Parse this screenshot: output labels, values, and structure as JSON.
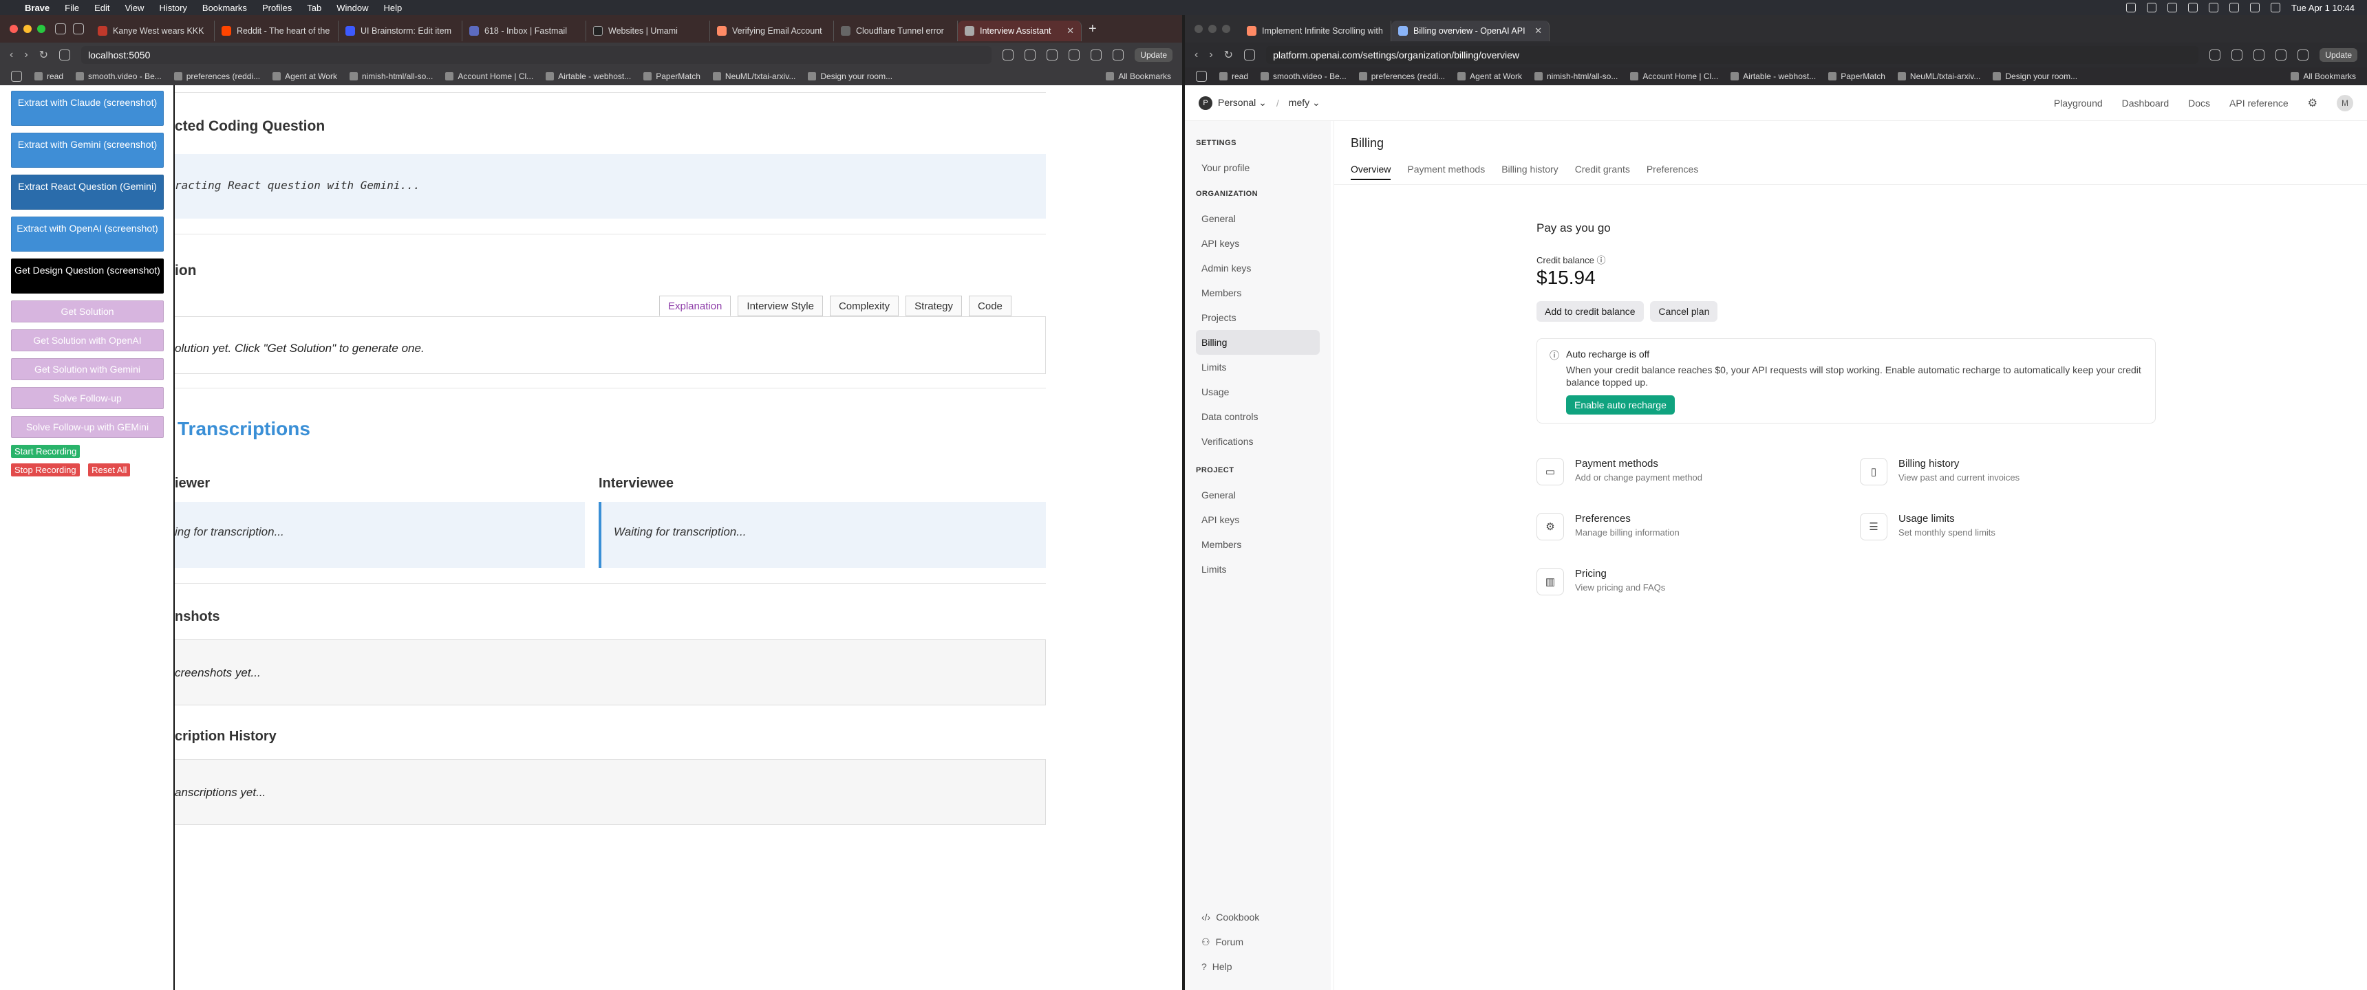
{
  "menubar": {
    "app": "Brave",
    "items": [
      "File",
      "Edit",
      "View",
      "History",
      "Bookmarks",
      "Profiles",
      "Tab",
      "Window",
      "Help"
    ],
    "clock": "Tue Apr 1  10:44"
  },
  "left_window": {
    "tabs": [
      {
        "title": "Kanye West wears KKK",
        "color": "#c0392b"
      },
      {
        "title": "Reddit - The heart of the",
        "color": "#ff4500"
      },
      {
        "title": "UI Brainstorm: Edit item",
        "color": "#3d5afe"
      },
      {
        "title": "618 - Inbox | Fastmail",
        "color": "#5c6bc0"
      },
      {
        "title": "Websites | Umami",
        "color": "#222"
      },
      {
        "title": "Verifying Email Account",
        "color": "#ff8a65"
      },
      {
        "title": "Cloudflare Tunnel error",
        "color": "#666"
      },
      {
        "title": "Interview Assistant",
        "color": "#aaa"
      }
    ],
    "url": "localhost:5050",
    "update_label": "Update",
    "bookmarks": [
      "read",
      "smooth.video - Be...",
      "preferences (reddi...",
      "Agent at Work",
      "nimish-html/all-so...",
      "Account Home | Cl...",
      "Airtable - webhost...",
      "PaperMatch",
      "NeuML/txtai-arxiv...",
      "Design your room..."
    ],
    "all_bookmarks": "All Bookmarks",
    "sidebar_buttons": [
      {
        "label": "Extract with Claude (screenshot)",
        "style": "blue"
      },
      {
        "label": "Extract with Gemini (screenshot)",
        "style": "blue"
      },
      {
        "label": "Extract React Question (Gemini)",
        "style": "dblue"
      },
      {
        "label": "Extract with OpenAI (screenshot)",
        "style": "blue"
      },
      {
        "label": "Get Design Question (screenshot)",
        "style": "black"
      },
      {
        "label": "Get Solution",
        "style": "lilac"
      },
      {
        "label": "Get Solution with OpenAI",
        "style": "lilac"
      },
      {
        "label": "Get Solution with Gemini",
        "style": "lilac"
      },
      {
        "label": "Solve Follow-up",
        "style": "lilac"
      },
      {
        "label": "Solve Follow-up with GEMini",
        "style": "lilac"
      }
    ],
    "start_recording": "Start Recording",
    "stop_recording": "Stop Recording",
    "reset_all": "Reset All",
    "extracted_heading": "cted Coding Question",
    "extracting_text": "racting React question with Gemini...",
    "solution_heading": "ion",
    "solution_tabs": [
      "Explanation",
      "Interview Style",
      "Complexity",
      "Strategy",
      "Code"
    ],
    "solution_text": "olution yet. Click \"Get Solution\" to generate one.",
    "transcriptions_heading": "Transcriptions",
    "interviewer_heading": "iewer",
    "interviewee_heading": "Interviewee",
    "interviewer_text": "ing for transcription...",
    "interviewee_text": "Waiting for transcription...",
    "screenshots_heading": "nshots",
    "screenshots_text": "creenshots yet...",
    "history_heading": "cription History",
    "history_text": "anscriptions yet..."
  },
  "right_window": {
    "tabs": [
      {
        "title": "Implement Infinite Scrolling with",
        "color": "#ff8a65"
      },
      {
        "title": "Billing overview - OpenAI API",
        "color": "#aaa"
      }
    ],
    "url": "platform.openai.com/settings/organization/billing/overview",
    "update_label": "Update",
    "bookmarks": [
      "read",
      "smooth.video - Be...",
      "preferences (reddi...",
      "Agent at Work",
      "nimish-html/all-so...",
      "Account Home | Cl...",
      "Airtable - webhost...",
      "PaperMatch",
      "NeuML/txtai-arxiv...",
      "Design your room..."
    ],
    "all_bookmarks": "All Bookmarks",
    "org_initial": "P",
    "org": "Personal",
    "project": "mefy",
    "top_links": [
      "Playground",
      "Dashboard",
      "Docs",
      "API reference"
    ],
    "avatar": "M",
    "settings_header": "SETTINGS",
    "your_profile": "Your profile",
    "organization_header": "ORGANIZATION",
    "org_items": [
      "General",
      "API keys",
      "Admin keys",
      "Members",
      "Projects",
      "Billing",
      "Limits",
      "Usage",
      "Data controls",
      "Verifications"
    ],
    "project_header": "PROJECT",
    "project_items": [
      "General",
      "API keys",
      "Members",
      "Limits"
    ],
    "bottom_items": [
      "Cookbook",
      "Forum",
      "Help"
    ],
    "page_title": "Billing",
    "subtabs": [
      "Overview",
      "Payment methods",
      "Billing history",
      "Credit grants",
      "Preferences"
    ],
    "plan": "Pay as you go",
    "credit_label": "Credit balance",
    "credit_value": "$15.94",
    "add_credit": "Add to credit balance",
    "cancel_plan": "Cancel plan",
    "auto_title": "Auto recharge is off",
    "auto_desc": "When your credit balance reaches $0, your API requests will stop working. Enable automatic recharge to automatically keep your credit balance topped up.",
    "enable_auto": "Enable auto recharge",
    "links": [
      {
        "title": "Payment methods",
        "sub": "Add or change payment method",
        "icon": "card-icon"
      },
      {
        "title": "Billing history",
        "sub": "View past and current invoices",
        "icon": "document-icon"
      },
      {
        "title": "Preferences",
        "sub": "Manage billing information",
        "icon": "gear-icon"
      },
      {
        "title": "Usage limits",
        "sub": "Set monthly spend limits",
        "icon": "sliders-icon"
      },
      {
        "title": "Pricing",
        "sub": "View pricing and FAQs",
        "icon": "chart-icon"
      }
    ],
    "accent": "#10a37f"
  }
}
